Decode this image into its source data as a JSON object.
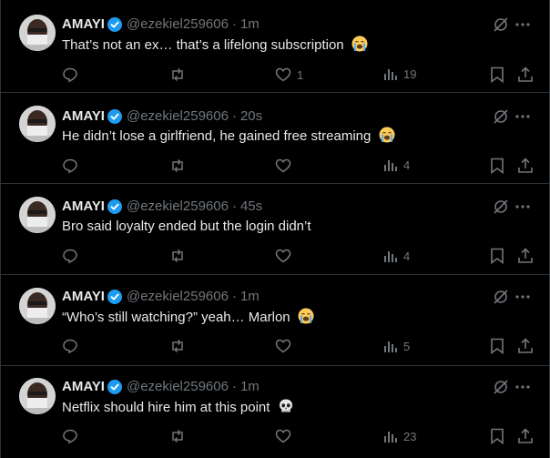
{
  "tweets": [
    {
      "name": "AMAYI",
      "handle": "@ezekiel259606",
      "sep": "·",
      "time": "1m",
      "text": "That’s not an ex… that’s a lifelong subscription",
      "emoji": "crying-face-emoji",
      "replies": "",
      "reposts": "",
      "likes": "1",
      "views": "19",
      "liked_icon": "heart-icon"
    },
    {
      "name": "AMAYI",
      "handle": "@ezekiel259606",
      "sep": "·",
      "time": "20s",
      "text": "He didn’t lose a girlfriend, he gained free streaming",
      "emoji": "crying-face-emoji",
      "replies": "",
      "reposts": "",
      "likes": "",
      "views": "4"
    },
    {
      "name": "AMAYI",
      "handle": "@ezekiel259606",
      "sep": "·",
      "time": "45s",
      "text": "Bro said loyalty ended but the login didn’t",
      "emoji": "",
      "replies": "",
      "reposts": "",
      "likes": "",
      "views": "4"
    },
    {
      "name": "AMAYI",
      "handle": "@ezekiel259606",
      "sep": "·",
      "time": "1m",
      "text": "“Who’s still watching?” yeah… Marlon",
      "emoji": "crying-face-emoji",
      "replies": "",
      "reposts": "",
      "likes": "",
      "views": "5"
    },
    {
      "name": "AMAYI",
      "handle": "@ezekiel259606",
      "sep": "·",
      "time": "1m",
      "text": "Netflix should hire him at this point",
      "emoji": "skull-emoji",
      "replies": "",
      "reposts": "",
      "likes": "",
      "views": "23"
    }
  ],
  "colors": {
    "background": "#000000",
    "text": "#e7e9ea",
    "muted": "#71767b",
    "verified": "#1d9bf0",
    "divider": "#2f3336"
  }
}
